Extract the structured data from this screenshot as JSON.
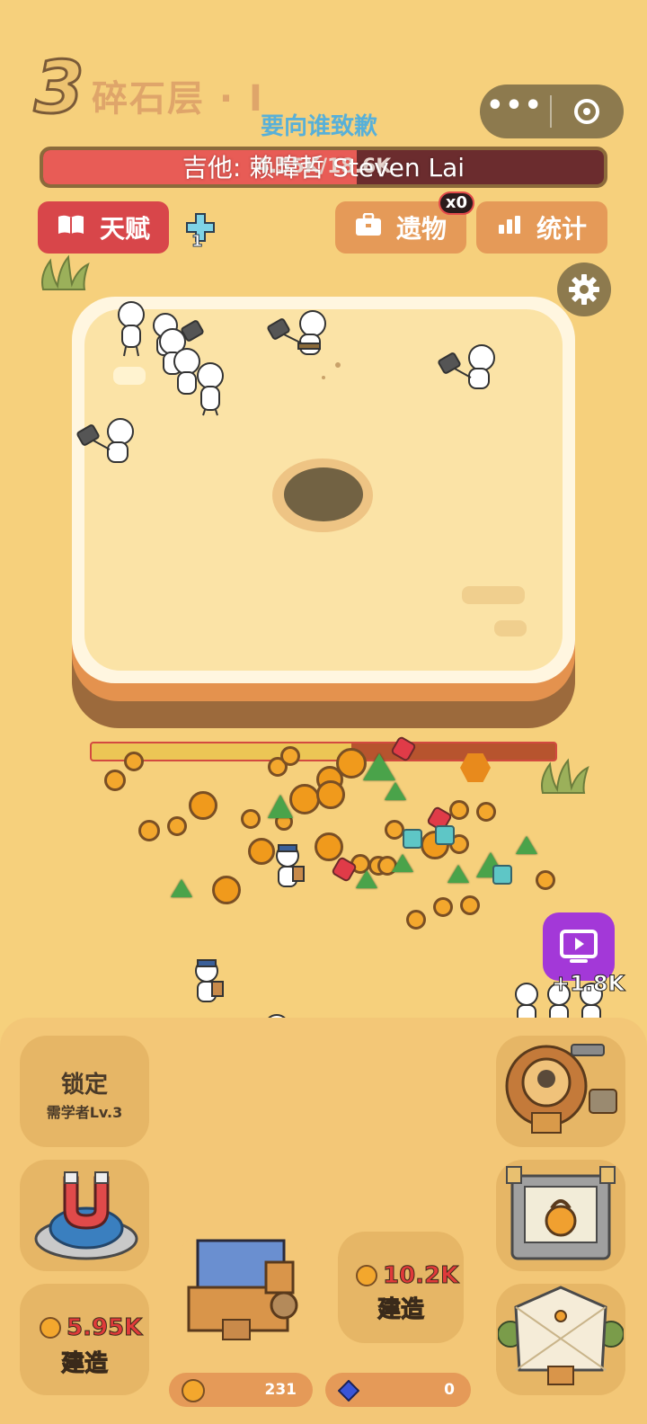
{
  "level": {
    "number": "3",
    "name": "碎石层 · I"
  },
  "overlay_title": "要向谁致歉",
  "boss_hp": {
    "text": "4.55K/18.6K",
    "fraction": 0.56
  },
  "subtitle": "吉他: 赖暐哲 Steven Lai",
  "buttons": {
    "talent": "天赋",
    "relic": "遗物",
    "relic_badge": "x0",
    "stats": "统计"
  },
  "cross_count": "1",
  "dig_progress": 0.56,
  "ad_bonus": "+1.8K",
  "locked_slot": {
    "title": "锁定",
    "requirement": "需学者Lv.3"
  },
  "build_left": {
    "cost": "5.95K",
    "label": "建造"
  },
  "build_mid": {
    "cost": "10.2K",
    "label": "建造"
  },
  "resources": {
    "coins": "231",
    "gems": "0"
  },
  "colors": {
    "background": "#f6d07c",
    "accent_red": "#d8464a",
    "accent_orange": "#e59a58",
    "video_purple": "#a338d8"
  },
  "icons": [
    "book-icon",
    "briefcase-icon",
    "bar-chart-icon",
    "gear-icon",
    "video-play-icon",
    "coin-icon",
    "gem-icon",
    "cross-icon",
    "more-icon",
    "target-icon"
  ]
}
